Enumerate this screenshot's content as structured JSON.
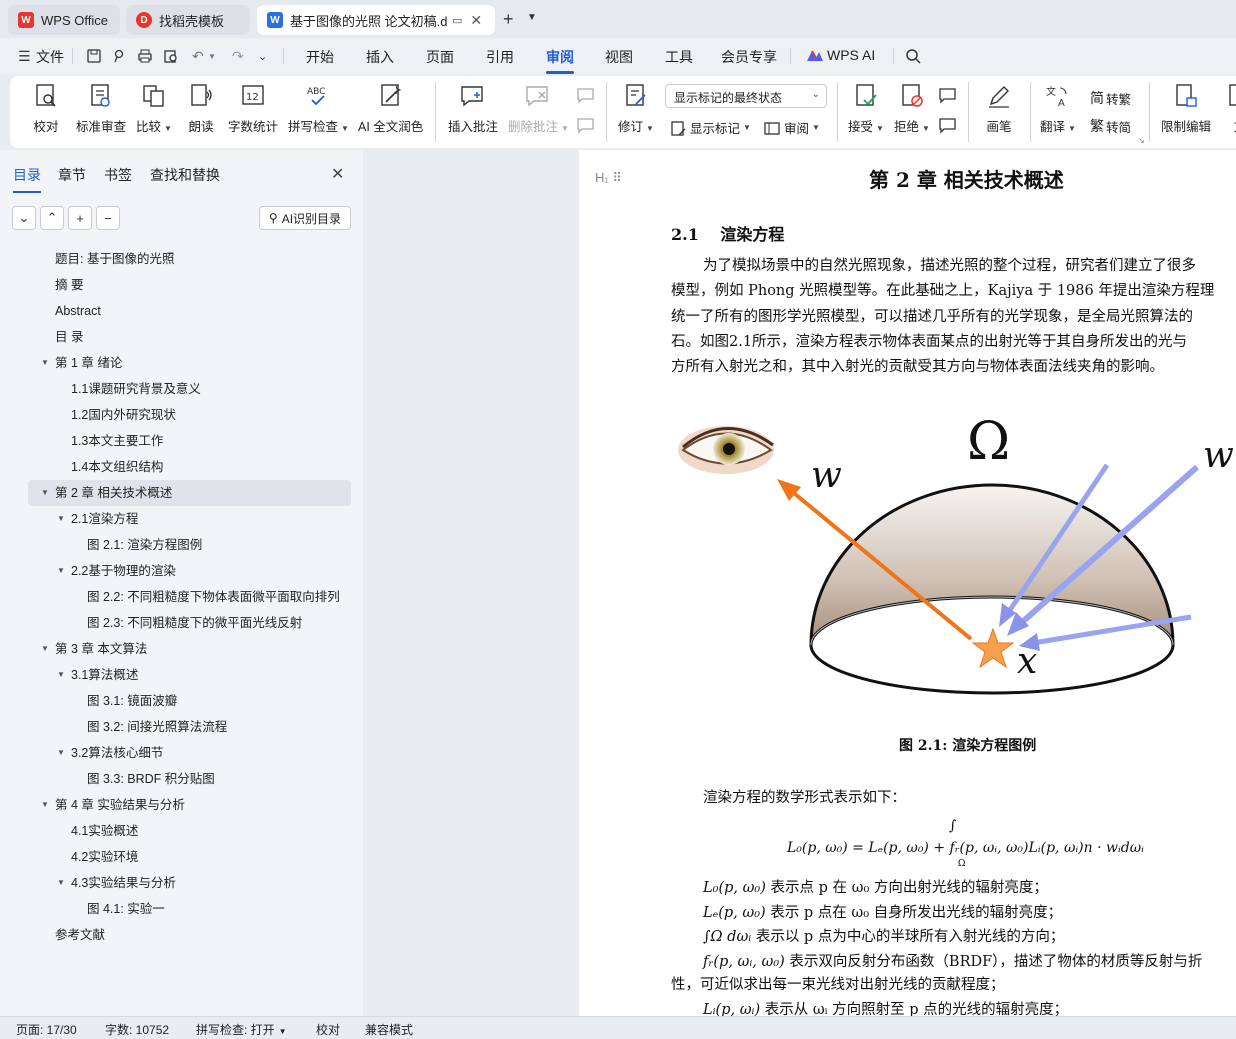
{
  "tabs": [
    {
      "label": "WPS Office",
      "logo": "W"
    },
    {
      "label": "找稻壳模板",
      "logo": "D"
    },
    {
      "label": "基于图像的光照 论文初稿.do",
      "logo": "W"
    }
  ],
  "menu": {
    "file": "文件",
    "items": [
      "开始",
      "插入",
      "页面",
      "引用",
      "审阅",
      "视图",
      "工具",
      "会员专享"
    ],
    "active": "审阅",
    "ai": "WPS AI"
  },
  "ribbon": {
    "proofread": "校对",
    "standard_review": "标准审查",
    "compare": "比较",
    "read_aloud": "朗读",
    "word_count": "字数统计",
    "spell_check": "拼写检查",
    "ai_polish": "AI 全文润色",
    "insert_comment": "插入批注",
    "delete_comment": "删除批注",
    "track_changes": "修订",
    "display_state": "显示标记的最终状态",
    "show_markup": "显示标记",
    "review": "审阅",
    "accept": "接受",
    "reject": "拒绝",
    "pen": "画笔",
    "translate": "翻译",
    "to_traditional": "转繁",
    "to_simplified": "转简",
    "restrict_edit": "限制编辑",
    "doc_partial": "文"
  },
  "nav": {
    "tabs": [
      "目录",
      "章节",
      "书签",
      "查找和替换"
    ],
    "ai_toc": "AI识别目录",
    "toc": [
      {
        "level": 0,
        "label": "题目:  基于图像的光照",
        "toggle": false
      },
      {
        "level": 0,
        "label": "摘 要",
        "toggle": false
      },
      {
        "level": 0,
        "label": "Abstract",
        "toggle": false
      },
      {
        "level": 0,
        "label": "目 录",
        "toggle": false
      },
      {
        "level": 0,
        "label": "第 1 章  绪论",
        "toggle": true
      },
      {
        "level": 1,
        "label": "1.1课题研究背景及意义",
        "toggle": false
      },
      {
        "level": 1,
        "label": "1.2国内外研究现状",
        "toggle": false
      },
      {
        "level": 1,
        "label": "1.3本文主要工作",
        "toggle": false
      },
      {
        "level": 1,
        "label": "1.4本文组织结构",
        "toggle": false
      },
      {
        "level": 0,
        "label": "第 2 章  相关技术概述",
        "toggle": true,
        "selected": true
      },
      {
        "level": 1,
        "label": "2.1渲染方程",
        "toggle": true
      },
      {
        "level": 2,
        "label": "图 2.1: 渲染方程图例",
        "toggle": false
      },
      {
        "level": 1,
        "label": "2.2基于物理的渲染",
        "toggle": true
      },
      {
        "level": 2,
        "label": "图 2.2: 不同粗糙度下物体表面微平面取向排列",
        "toggle": false
      },
      {
        "level": 2,
        "label": "图 2.3: 不同粗糙度下的微平面光线反射",
        "toggle": false
      },
      {
        "level": 0,
        "label": "第 3 章  本文算法",
        "toggle": true
      },
      {
        "level": 1,
        "label": "3.1算法概述",
        "toggle": true
      },
      {
        "level": 2,
        "label": "图 3.1: 镜面波瓣",
        "toggle": false
      },
      {
        "level": 2,
        "label": "图 3.2: 间接光照算法流程",
        "toggle": false
      },
      {
        "level": 1,
        "label": "3.2算法核心细节",
        "toggle": true
      },
      {
        "level": 2,
        "label": "图 3.3: BRDF 积分贴图",
        "toggle": false
      },
      {
        "level": 0,
        "label": "第 4 章  实验结果与分析",
        "toggle": true
      },
      {
        "level": 1,
        "label": "4.1实验概述",
        "toggle": false
      },
      {
        "level": 1,
        "label": "4.2实验环境",
        "toggle": false
      },
      {
        "level": 1,
        "label": "4.3实验结果与分析",
        "toggle": true
      },
      {
        "level": 2,
        "label": "图 4.1: 实验一",
        "toggle": false
      },
      {
        "level": 0,
        "label": "参考文献",
        "toggle": false
      }
    ]
  },
  "doc": {
    "chapter_title": "第 2 章    相关技术概述",
    "section_num": "2.1",
    "section_title": "渲染方程",
    "para_lines": [
      "为了模拟场景中的自然光照现象，描述光照的整个过程，研究者们建立了很多",
      "模型，例如 Phong 光照模型等。在此基础之上，Kajiya 于 1986 年提出渲染方程理",
      "统一了所有的图形学光照模型，可以描述几乎所有的光学现象，是全局光照算法的",
      "石。如图2.1所示，渲染方程表示物体表面某点的出射光等于其自身所发出的光与",
      "方所有入射光之和，其中入射光的贡献受其方向与物体表面法线夹角的影响。"
    ],
    "figure": {
      "omega": "Ω",
      "w_out": "w",
      "w_in": "w",
      "x": "x"
    },
    "figure_caption": "图  2.1: 渲染方程图例",
    "eq_intro": "渲染方程的数学形式表示如下：",
    "equation": "L₀(p, ω₀) = Lₑ(p, ω₀) +      fᵣ(p, ωᵢ, ω₀)Lᵢ(p, ωᵢ)n · wᵢdωᵢ",
    "eq_integral": "∫",
    "eq_domain": "Ω",
    "defs": [
      {
        "sym": "L₀(p, ω₀)",
        "text": " 表示点  p 在  ω₀ 方向出射光线的辐射亮度；"
      },
      {
        "sym": "Lₑ(p, ω₀)",
        "text": " 表示  p 点在  ω₀ 自身所发出光线的辐射亮度；"
      },
      {
        "sym": "∫Ω dωᵢ",
        "text": " 表示以  p 点为中心的半球所有入射光线的方向；"
      },
      {
        "sym": "fᵣ(p, ωᵢ, ω₀)",
        "text": " 表示双向反射分布函数（BRDF），描述了物体的材质等反射与折"
      },
      {
        "sym": "",
        "text": "性，可近似求出每一束光线对出射光线的贡献程度；"
      },
      {
        "sym": "Lᵢ(p, ωᵢ)",
        "text": " 表示从  ωᵢ 方向照射至  p 点的光线的辐射亮度；"
      }
    ]
  },
  "status": {
    "page": "页面: 17/30",
    "words": "字数: 10752",
    "spell": "拼写检查: 打开",
    "proof": "校对",
    "compat": "兼容模式"
  },
  "colors": {
    "accent": "#1f5fd6",
    "wps_red": "#e8352e",
    "arrow_out": "#f07418",
    "arrow_in": "#9aa3f0"
  }
}
